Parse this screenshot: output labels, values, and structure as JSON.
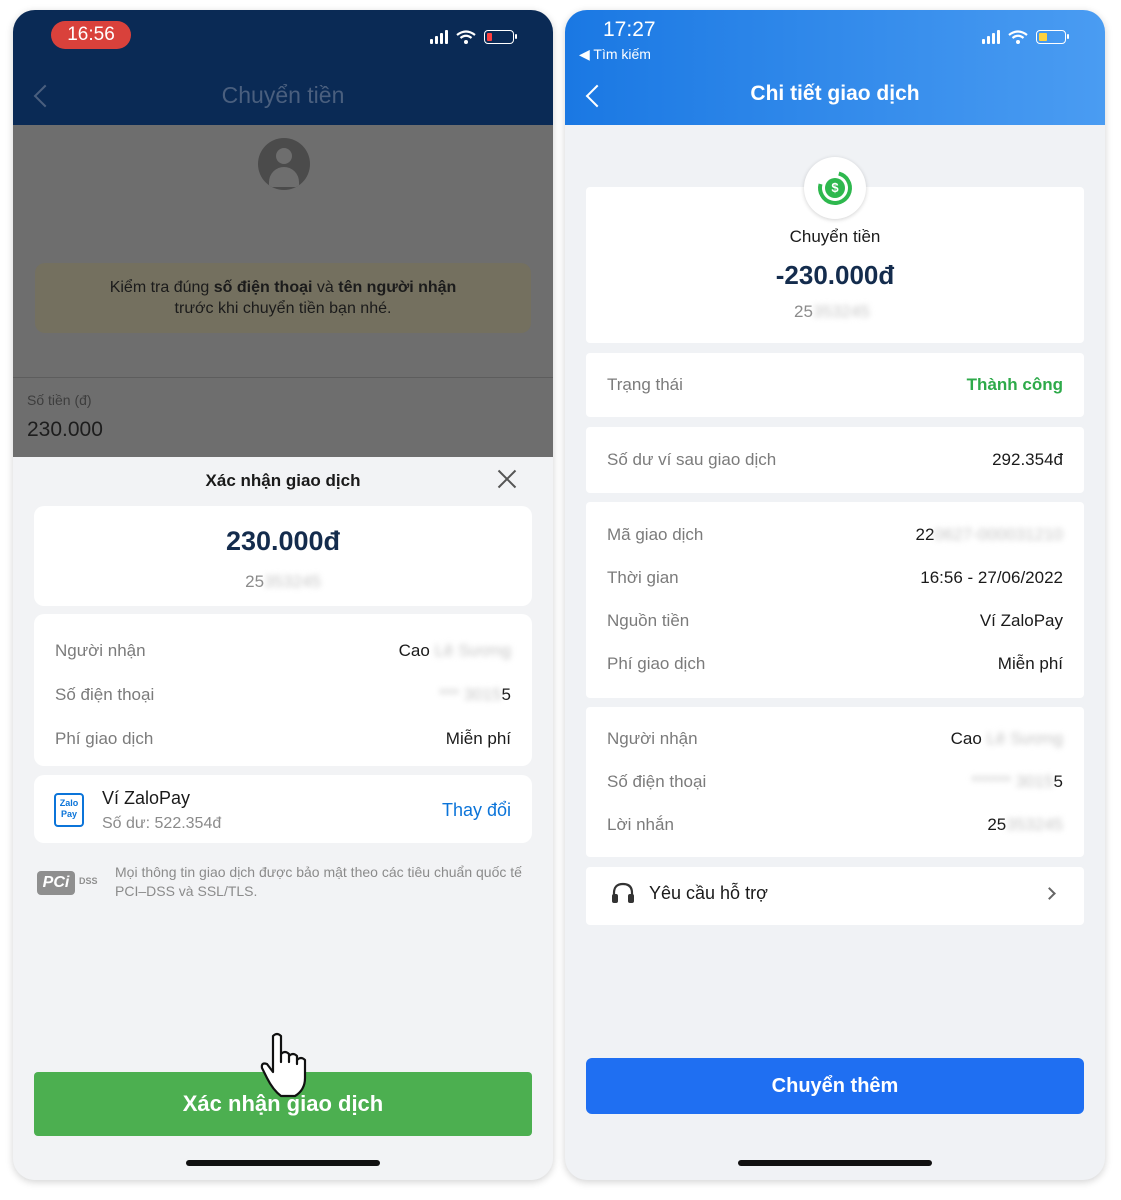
{
  "left": {
    "status": {
      "time": "16:56",
      "time_pill_color": "#d9413b"
    },
    "header": {
      "title": "Chuyển tiền"
    },
    "notice": {
      "prefix": "Kiểm tra đúng ",
      "bold1": "số điện thoại",
      "mid": " và ",
      "bold2": "tên người nhận",
      "line2": "trước khi chuyển tiền bạn nhé."
    },
    "amount_field": {
      "label": "Số tiền (đ)",
      "value": "230.000"
    },
    "sheet": {
      "title": "Xác nhận giao dịch",
      "amount": "230.000đ",
      "ref_visible": "25",
      "ref_blurred": "353245",
      "rows": [
        {
          "label": "Người nhận",
          "value": "Cao",
          "value_blurred": "Lê Sương"
        },
        {
          "label": "Số điện thoại",
          "value_blurred": "*** 3015",
          "value": "5"
        },
        {
          "label": "Phí giao dịch",
          "value": "Miễn phí"
        }
      ],
      "wallet": {
        "logo_text": "Zalo Pay",
        "name": "Ví ZaloPay",
        "balance": "Số dư: 522.354đ",
        "change": "Thay đổi"
      },
      "pci": {
        "logo": "PCi",
        "logo_sub": "DSS",
        "text": "Mọi thông tin giao dịch được bảo mật theo các tiêu chuẩn quốc tế PCI–DSS và SSL/TLS."
      },
      "confirm_button": "Xác nhận giao dịch"
    }
  },
  "right": {
    "status": {
      "time": "17:27",
      "back_link": "◀ Tìm kiếm"
    },
    "header": {
      "title": "Chi tiết giao dịch"
    },
    "summary": {
      "type": "Chuyển tiền",
      "amount": "-230.000đ",
      "ref_visible": "25",
      "ref_blurred": "353245"
    },
    "status_row": {
      "label": "Trạng thái",
      "value": "Thành công",
      "color": "#2eaa4a"
    },
    "balance_row": {
      "label": "Số dư ví sau giao dịch",
      "value": "292.354đ"
    },
    "details": [
      {
        "label": "Mã giao dịch",
        "value": "22",
        "value_blurred": "0627-000031210"
      },
      {
        "label": "Thời gian",
        "value": "16:56 - 27/06/2022"
      },
      {
        "label": "Nguồn tiền",
        "value": "Ví ZaloPay"
      },
      {
        "label": "Phí giao dịch",
        "value": "Miễn phí"
      }
    ],
    "recipient": [
      {
        "label": "Người nhận",
        "value": "Cao",
        "value_blurred": "Lê Sương"
      },
      {
        "label": "Số điện thoại",
        "value_blurred": "****** 3015",
        "value": "5"
      },
      {
        "label": "Lời nhắn",
        "value": "25",
        "value_blurred": "353245"
      }
    ],
    "support": {
      "label": "Yêu cầu hỗ trợ"
    },
    "more_button": "Chuyển thêm",
    "accent": "#1f6ff2"
  }
}
